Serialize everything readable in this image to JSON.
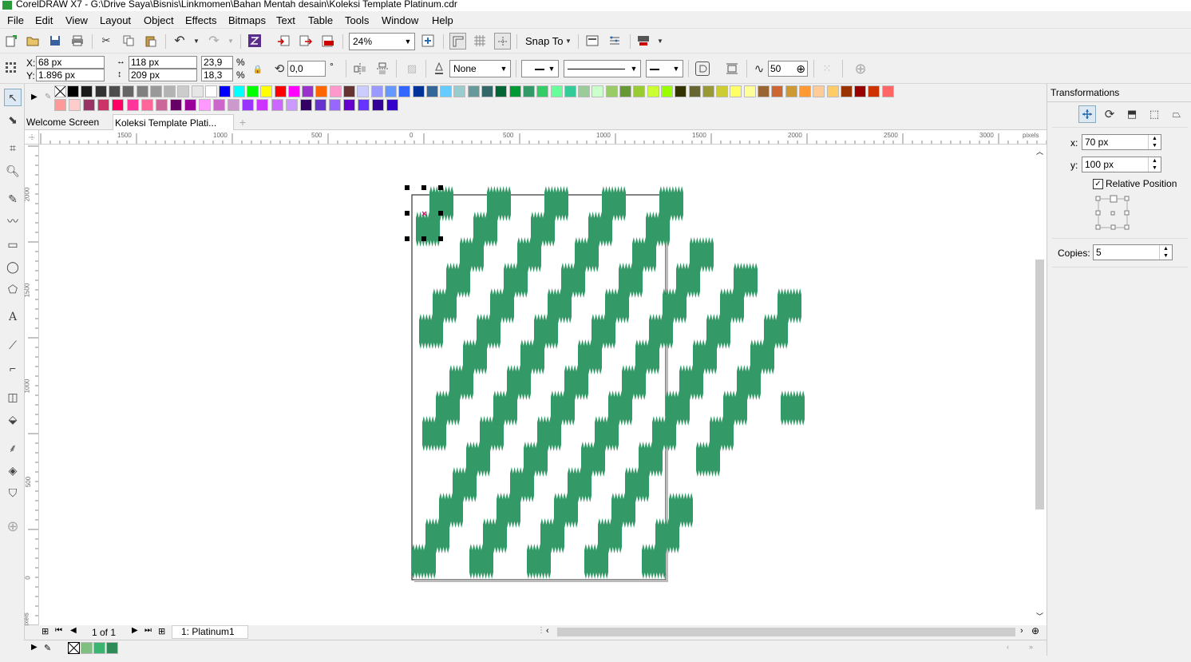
{
  "window": {
    "title": "CorelDRAW X7 - G:\\Drive Saya\\Bisnis\\Linkmomen\\Bahan Mentah desain\\Koleksi Template Platinum.cdr"
  },
  "menu": [
    "File",
    "Edit",
    "View",
    "Layout",
    "Object",
    "Effects",
    "Bitmaps",
    "Text",
    "Table",
    "Tools",
    "Window",
    "Help"
  ],
  "toolbar": {
    "zoom": "24%",
    "snap_to": "Snap To"
  },
  "property_bar": {
    "x_label": "X:",
    "x": "68 px",
    "y_label": "Y:",
    "y": "1.896 px",
    "width": "118 px",
    "height": "209 px",
    "scale_w": "23,9",
    "scale_h": "18,3",
    "percent": "%",
    "angle": "0,0",
    "degree": "°",
    "outline_none": "None",
    "nodes": "50"
  },
  "tabs": {
    "welcome": "Welcome Screen",
    "document": "Koleksi Template Plati..."
  },
  "ruler": {
    "h_ticks": [
      "1500",
      "1000",
      "500",
      "0",
      "500",
      "1000",
      "1500",
      "2000",
      "2500",
      "3000"
    ],
    "h_unit": "pixels",
    "v_ticks": [
      "2000",
      "1500",
      "1000",
      "500",
      "0"
    ],
    "v_unit": "pixels"
  },
  "page_nav": {
    "page_of": "1 of 1",
    "page_tab": "1: Platinum1"
  },
  "docker": {
    "title": "Transformations",
    "x_label": "x:",
    "x_value": "70 px",
    "y_label": "y:",
    "y_value": "100 px",
    "relative_position": "Relative Position",
    "copies_label": "Copies:",
    "copies_value": "5"
  },
  "colors": {
    "pattern_green": "#339966",
    "accent": "#2b9a3a"
  },
  "palette_row1": [
    "#000000",
    "#1a1a1a",
    "#333333",
    "#4d4d4d",
    "#666666",
    "#808080",
    "#999999",
    "#b3b3b3",
    "#cccccc",
    "#e6e6e6",
    "#ffffff",
    "#0000ff",
    "#00ffff",
    "#00ff00",
    "#ffff00",
    "#ff0000",
    "#ff00ff",
    "#9933cc",
    "#ff6600",
    "#ff99cc",
    "#663333",
    "#ccccff",
    "#9999ff",
    "#6699ff",
    "#3366ff",
    "#003399",
    "#336699",
    "#66ccff",
    "#99cccc",
    "#669999",
    "#336666",
    "#006633",
    "#009933",
    "#339966",
    "#33cc66",
    "#66ff99",
    "#33cc99",
    "#99cc99",
    "#ccffcc",
    "#99cc66",
    "#669933",
    "#99cc33",
    "#ccff33",
    "#99ff00",
    "#333300",
    "#666633",
    "#999933",
    "#cccc33",
    "#ffff66",
    "#ffff99",
    "#996633",
    "#cc6633",
    "#cc9933",
    "#ff9933",
    "#ffcc99",
    "#ffcc66",
    "#993300",
    "#990000",
    "#cc3300",
    "#ff6666"
  ],
  "palette_row2": [
    "#ff9999",
    "#ffcccc",
    "#993366",
    "#cc3366",
    "#ff0066",
    "#ff3399",
    "#ff6699",
    "#cc6699",
    "#660066",
    "#990099",
    "#ff99ff",
    "#cc66cc",
    "#cc99cc",
    "#9933ff",
    "#cc33ff",
    "#cc66ff",
    "#cc99ff",
    "#330066",
    "#6633cc",
    "#9966ff",
    "#6600cc",
    "#6633ff",
    "#330099",
    "#3300cc"
  ],
  "status_swatches": [
    "#ffffff",
    "#7fbf7f",
    "#3cb371",
    "#2e8b57"
  ]
}
